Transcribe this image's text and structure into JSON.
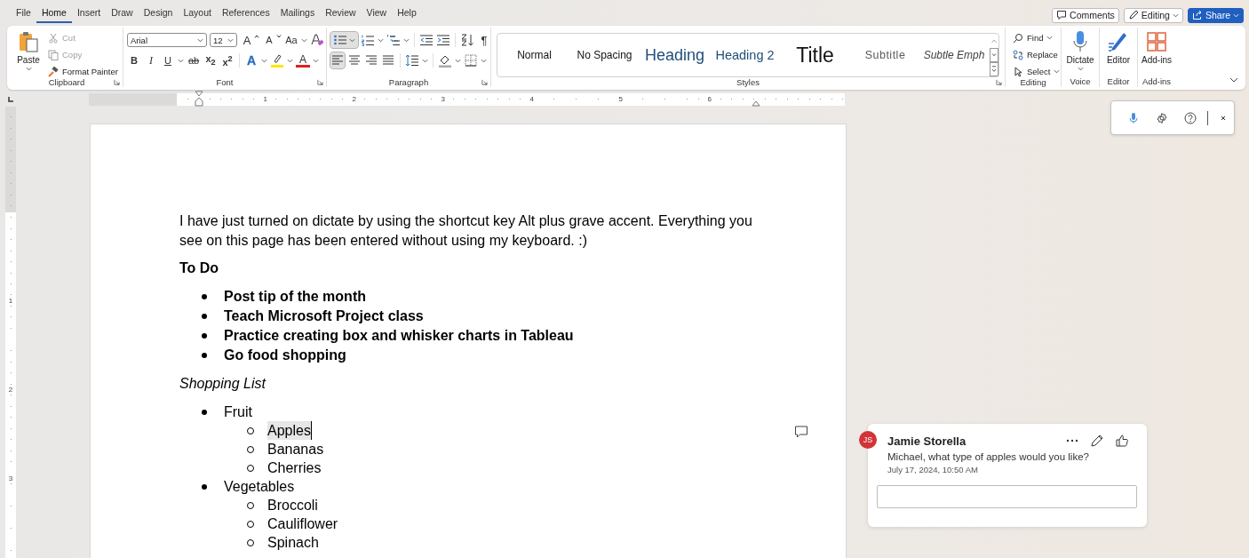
{
  "menu_tabs": [
    {
      "label": "File",
      "selected": false
    },
    {
      "label": "Home",
      "selected": true
    },
    {
      "label": "Insert",
      "selected": false
    },
    {
      "label": "Draw",
      "selected": false
    },
    {
      "label": "Design",
      "selected": false
    },
    {
      "label": "Layout",
      "selected": false
    },
    {
      "label": "References",
      "selected": false
    },
    {
      "label": "Mailings",
      "selected": false
    },
    {
      "label": "Review",
      "selected": false
    },
    {
      "label": "View",
      "selected": false
    },
    {
      "label": "Help",
      "selected": false
    }
  ],
  "top_buttons": {
    "comments": "Comments",
    "editing": "Editing",
    "share": "Share"
  },
  "clipboard": {
    "paste": "Paste",
    "cut": {
      "label": "Cut",
      "disabled": true
    },
    "copy": {
      "label": "Copy",
      "disabled": true
    },
    "format_painter": "Format Painter",
    "group_label": "Clipboard"
  },
  "font": {
    "name": "Arial",
    "size": "12",
    "grow": "A",
    "shrink": "A",
    "change_case": "Aa",
    "bold": "B",
    "italic": "I",
    "underline": "U",
    "strikethrough": "ab",
    "subscript": "x$_{2}$",
    "superscript": "x$^{2}$",
    "text_effects": "A",
    "font_color": "A",
    "group_label": "Font"
  },
  "paragraph": {
    "bullets_selected": true,
    "show_marks": "¶",
    "alignments": [
      {
        "selected": true
      },
      {
        "selected": false
      },
      {
        "selected": false
      },
      {
        "selected": false
      }
    ],
    "group_label": "Paragraph"
  },
  "styles": {
    "items": [
      {
        "label": "Normal",
        "kind": "normal"
      },
      {
        "label": "No Spacing",
        "kind": "normal"
      },
      {
        "label": "Heading",
        "kind": "heading1"
      },
      {
        "label": "Heading 2",
        "kind": "heading2"
      },
      {
        "label": "Title",
        "kind": "title"
      },
      {
        "label": "Subtitle",
        "kind": "subtitle"
      },
      {
        "label": "Subtle Emph",
        "kind": "subtle"
      }
    ],
    "group_label": "Styles"
  },
  "editing": {
    "find": "Find",
    "replace": "Replace",
    "select": "Select",
    "group_label": "Editing"
  },
  "voice": {
    "dictate": "Dictate",
    "group_label": "Voice"
  },
  "editor": {
    "label": "Editor",
    "group_label": "Editor"
  },
  "addins": {
    "label": "Add-ins",
    "group_label": "Add-ins"
  },
  "ruler": {
    "numbers": [
      "1",
      "2",
      "3",
      "4",
      "5",
      "6"
    ]
  },
  "vertical_ruler": {
    "numbers": [
      "1",
      "2",
      "3"
    ]
  },
  "document": {
    "intro": "I have just turned on dictate by using the shortcut key Alt plus grave accent. Everything you see on this page has been entered without using my keyboard. :)",
    "todo_title": "To Do",
    "todo_items": [
      "Post tip of the month",
      "Teach Microsoft Project class",
      "Practice creating box and whisker charts in Tableau",
      "Go food shopping"
    ],
    "shopping_title": "Shopping List",
    "shopping": [
      {
        "label": "Fruit",
        "children": [
          {
            "label": "Apples",
            "commented": true
          },
          {
            "label": "Bananas",
            "commented": false
          },
          {
            "label": "Cherries",
            "commented": false
          }
        ]
      },
      {
        "label": "Vegetables",
        "children": [
          {
            "label": "Broccoli",
            "commented": false
          },
          {
            "label": "Cauliflower",
            "commented": false
          },
          {
            "label": "Spinach",
            "commented": false
          }
        ]
      }
    ]
  },
  "dictate_toolbar": {
    "mic_on": true
  },
  "comment": {
    "initials": "JS",
    "color": "#d13438",
    "author": "Jamie Storella",
    "text": "Michael, what type of apples would you like?",
    "date": "July 17, 2024, 10:50 AM"
  }
}
